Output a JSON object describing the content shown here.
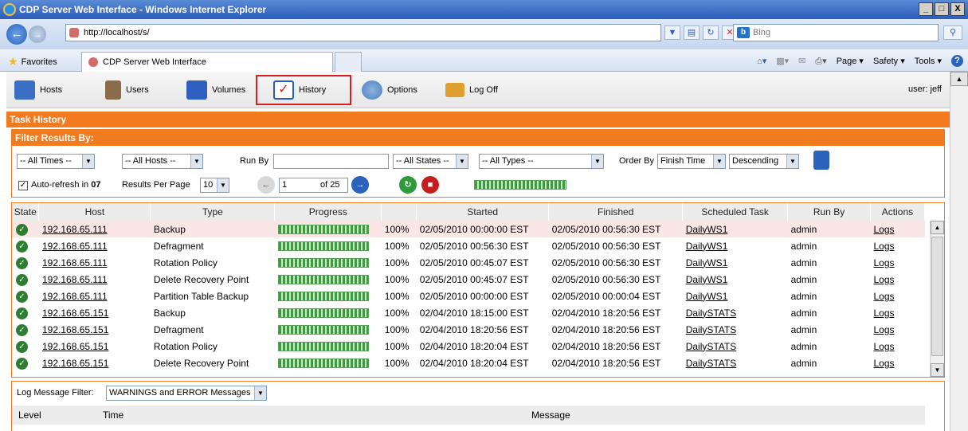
{
  "window": {
    "title": "CDP Server Web Interface - Windows Internet Explorer",
    "buttons": [
      "_",
      "□",
      "X"
    ]
  },
  "browser": {
    "url": "http://localhost/s/",
    "search_placeholder": "Bing",
    "search_logo": "b",
    "favorites_label": "Favorites",
    "tab_title": "CDP Server Web Interface",
    "commands": [
      "Page ▾",
      "Safety ▾",
      "Tools ▾"
    ],
    "help_icon": "?"
  },
  "toolbar": {
    "items": [
      {
        "label": "Hosts",
        "icon": "hosts-icon",
        "color": "#3b6fc4"
      },
      {
        "label": "Users",
        "icon": "users-icon",
        "color": "#8a6b4a"
      },
      {
        "label": "Volumes",
        "icon": "volumes-icon",
        "color": "#2f5fbf"
      },
      {
        "label": "History",
        "icon": "history-icon",
        "color": "#2b5cb8"
      },
      {
        "label": "Options",
        "icon": "options-icon",
        "color": "#4a7fc0"
      },
      {
        "label": "Log Off",
        "icon": "logoff-icon",
        "color": "#e0a030"
      }
    ],
    "user": "user: jeff"
  },
  "panel_title": "Task History",
  "filter": {
    "title": "Filter Results By:",
    "times": "-- All Times --",
    "hosts": "-- All Hosts --",
    "run_by_label": "Run By",
    "run_by_value": "",
    "states": "-- All States --",
    "types": "-- All Types --",
    "order_by_label": "Order By",
    "order_field": "Finish Time",
    "order_dir": "Descending",
    "auto_refresh_label": "Auto-refresh in",
    "auto_refresh_seconds": "07",
    "results_per_page_label": "Results Per Page",
    "results_per_page": "10",
    "page": "1",
    "page_of": "of 25"
  },
  "table": {
    "columns": [
      "State",
      "Host",
      "Type",
      "Progress",
      "",
      "Started",
      "Finished",
      "Scheduled Task",
      "Run By",
      "Actions"
    ],
    "rows": [
      {
        "host": "192.168.65.111",
        "type": "Backup",
        "pct": "100%",
        "started": "02/05/2010 00:00:00 EST",
        "finished": "02/05/2010 00:56:30 EST",
        "task": "DailyWS1",
        "runby": "admin",
        "action": "Logs"
      },
      {
        "host": "192.168.65.111",
        "type": "Defragment",
        "pct": "100%",
        "started": "02/05/2010 00:56:30 EST",
        "finished": "02/05/2010 00:56:30 EST",
        "task": "DailyWS1",
        "runby": "admin",
        "action": "Logs"
      },
      {
        "host": "192.168.65.111",
        "type": "Rotation Policy",
        "pct": "100%",
        "started": "02/05/2010 00:45:07 EST",
        "finished": "02/05/2010 00:56:30 EST",
        "task": "DailyWS1",
        "runby": "admin",
        "action": "Logs"
      },
      {
        "host": "192.168.65.111",
        "type": "Delete Recovery Point",
        "pct": "100%",
        "started": "02/05/2010 00:45:07 EST",
        "finished": "02/05/2010 00:56:30 EST",
        "task": "DailyWS1",
        "runby": "admin",
        "action": "Logs"
      },
      {
        "host": "192.168.65.111",
        "type": "Partition Table Backup",
        "pct": "100%",
        "started": "02/05/2010 00:00:00 EST",
        "finished": "02/05/2010 00:00:04 EST",
        "task": "DailyWS1",
        "runby": "admin",
        "action": "Logs"
      },
      {
        "host": "192.168.65.151",
        "type": "Backup",
        "pct": "100%",
        "started": "02/04/2010 18:15:00 EST",
        "finished": "02/04/2010 18:20:56 EST",
        "task": "DailySTATS",
        "runby": "admin",
        "action": "Logs"
      },
      {
        "host": "192.168.65.151",
        "type": "Defragment",
        "pct": "100%",
        "started": "02/04/2010 18:20:56 EST",
        "finished": "02/04/2010 18:20:56 EST",
        "task": "DailySTATS",
        "runby": "admin",
        "action": "Logs"
      },
      {
        "host": "192.168.65.151",
        "type": "Rotation Policy",
        "pct": "100%",
        "started": "02/04/2010 18:20:04 EST",
        "finished": "02/04/2010 18:20:56 EST",
        "task": "DailySTATS",
        "runby": "admin",
        "action": "Logs"
      },
      {
        "host": "192.168.65.151",
        "type": "Delete Recovery Point",
        "pct": "100%",
        "started": "02/04/2010 18:20:04 EST",
        "finished": "02/04/2010 18:20:56 EST",
        "task": "DailySTATS",
        "runby": "admin",
        "action": "Logs"
      }
    ]
  },
  "log": {
    "filter_label": "Log Message Filter:",
    "filter_value": "WARNINGS and ERROR Messages",
    "columns": [
      "Level",
      "Time",
      "Message"
    ]
  },
  "colors": {
    "accent": "#f27a1f",
    "highlight": "#d42020",
    "ok": "#2e7d32"
  }
}
